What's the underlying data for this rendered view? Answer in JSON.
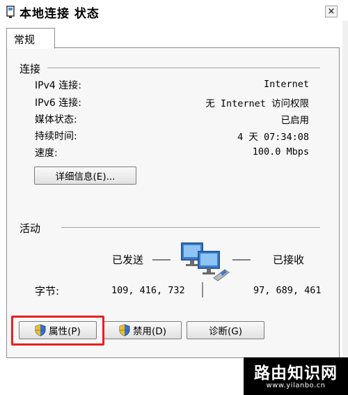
{
  "window": {
    "title": "本地连接 状态",
    "close_label": "×"
  },
  "tabs": [
    {
      "label": "常规"
    }
  ],
  "connection": {
    "section_title": "连接",
    "rows": [
      {
        "label": "IPv4 连接:",
        "value": "Internet"
      },
      {
        "label": "IPv6 连接:",
        "value": "无 Internet 访问权限"
      },
      {
        "label": "媒体状态:",
        "value": "已启用"
      },
      {
        "label": "持续时间:",
        "value": "4 天 07:34:08"
      },
      {
        "label": "速度:",
        "value": "100.0 Mbps"
      }
    ],
    "details_button": "详细信息(E)..."
  },
  "activity": {
    "section_title": "活动",
    "sent_label": "已发送",
    "received_label": "已接收",
    "bytes_label": "字节:",
    "bytes_sent": "109, 416, 732",
    "bytes_received": "97, 689, 461"
  },
  "buttons": {
    "properties": "属性(P)",
    "disable": "禁用(D)",
    "diagnose": "诊断(G)"
  },
  "highlight_color": "#e8201f",
  "watermark": {
    "title": "路由知识网",
    "url": "www.yilanbo.cn"
  }
}
